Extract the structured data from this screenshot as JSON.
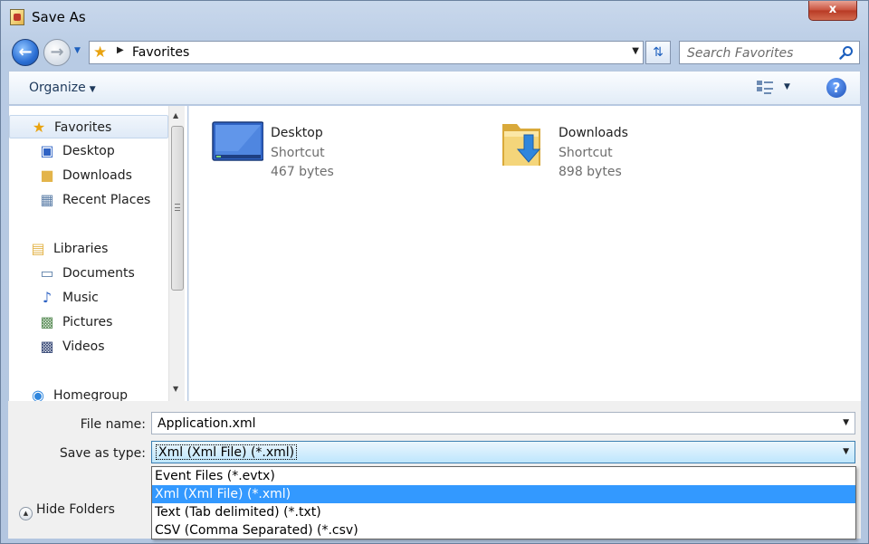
{
  "window": {
    "title": "Save As",
    "close_glyph": "x"
  },
  "address": {
    "location": "Favorites",
    "search_placeholder": "Search Favorites"
  },
  "toolbar": {
    "organize_label": "Organize",
    "help_glyph": "?"
  },
  "nav": {
    "items": [
      {
        "label": "Favorites",
        "icon": "star-icon",
        "indent": false,
        "selected": true
      },
      {
        "label": "Desktop",
        "icon": "desktop-icon",
        "indent": true,
        "selected": false
      },
      {
        "label": "Downloads",
        "icon": "downloads-folder-icon",
        "indent": true,
        "selected": false
      },
      {
        "label": "Recent Places",
        "icon": "recent-places-icon",
        "indent": true,
        "selected": false
      },
      {
        "label": "Libraries",
        "icon": "libraries-icon",
        "indent": false,
        "selected": false
      },
      {
        "label": "Documents",
        "icon": "documents-icon",
        "indent": true,
        "selected": false
      },
      {
        "label": "Music",
        "icon": "music-icon",
        "indent": true,
        "selected": false
      },
      {
        "label": "Pictures",
        "icon": "pictures-icon",
        "indent": true,
        "selected": false
      },
      {
        "label": "Videos",
        "icon": "videos-icon",
        "indent": true,
        "selected": false
      },
      {
        "label": "Homegroup",
        "icon": "homegroup-icon",
        "indent": false,
        "selected": false
      }
    ]
  },
  "files": [
    {
      "name": "Desktop",
      "type": "Shortcut",
      "size": "467 bytes",
      "icon": "desktop-shortcut-icon"
    },
    {
      "name": "Downloads",
      "type": "Shortcut",
      "size": "898 bytes",
      "icon": "downloads-shortcut-icon"
    }
  ],
  "form": {
    "file_name_label": "File name:",
    "file_name_value": "Application.xml",
    "save_type_label": "Save as type:",
    "save_type_value": "Xml (Xml File) (*.xml)",
    "type_options": [
      "Event Files (*.evtx)",
      "Xml (Xml File) (*.xml)",
      "Text (Tab delimited) (*.txt)",
      "CSV (Comma Separated) (*.csv)"
    ],
    "highlighted_option": 1,
    "hide_folders_label": "Hide Folders"
  },
  "colors": {
    "highlight": "#3399ff",
    "accent": "#1c5fbe"
  }
}
